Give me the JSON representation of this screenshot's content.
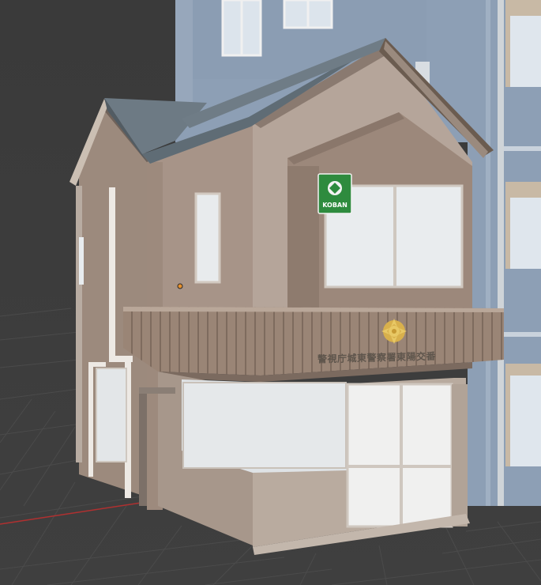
{
  "viewport": {
    "background_color": "#3b3b3b",
    "grid_color": "#4a4a4a",
    "x_axis_color": "#b03030"
  },
  "building": {
    "koban_sign": {
      "label": "KOBAN",
      "color": "#2e8b3e",
      "emblem": "police-emblem-icon"
    },
    "facade_sign_text": "警視庁城東警察署東陽交番",
    "emblem_icon": "police-sun-emblem-icon",
    "wall_color": "#a9968a",
    "roof_color": "#5e6b74"
  },
  "background_building": {
    "wall_color": "#8d9fb5"
  },
  "object_origin_marker": {
    "color": "#e8912c"
  }
}
